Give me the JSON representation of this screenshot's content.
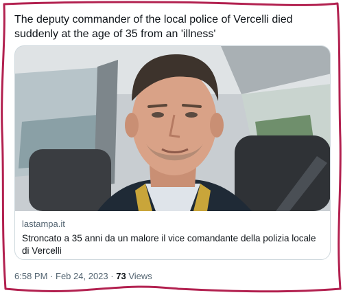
{
  "tweet": {
    "text": "The deputy commander of the local police of Vercelli died suddenly at the age of 35 from an 'illness'"
  },
  "card": {
    "domain": "lastampa.it",
    "title": "Stroncato a 35 anni da un malore il vice comandante della polizia locale di Vercelli",
    "image_description_icon": "portrait-photo"
  },
  "meta": {
    "time": "6:58 PM",
    "separator": "·",
    "date": "Feb 24, 2023",
    "views_count": "73",
    "views_label": "Views"
  },
  "colors": {
    "frame_outline": "#b2204f",
    "card_border": "#cfd9de",
    "secondary_text": "#536471"
  }
}
